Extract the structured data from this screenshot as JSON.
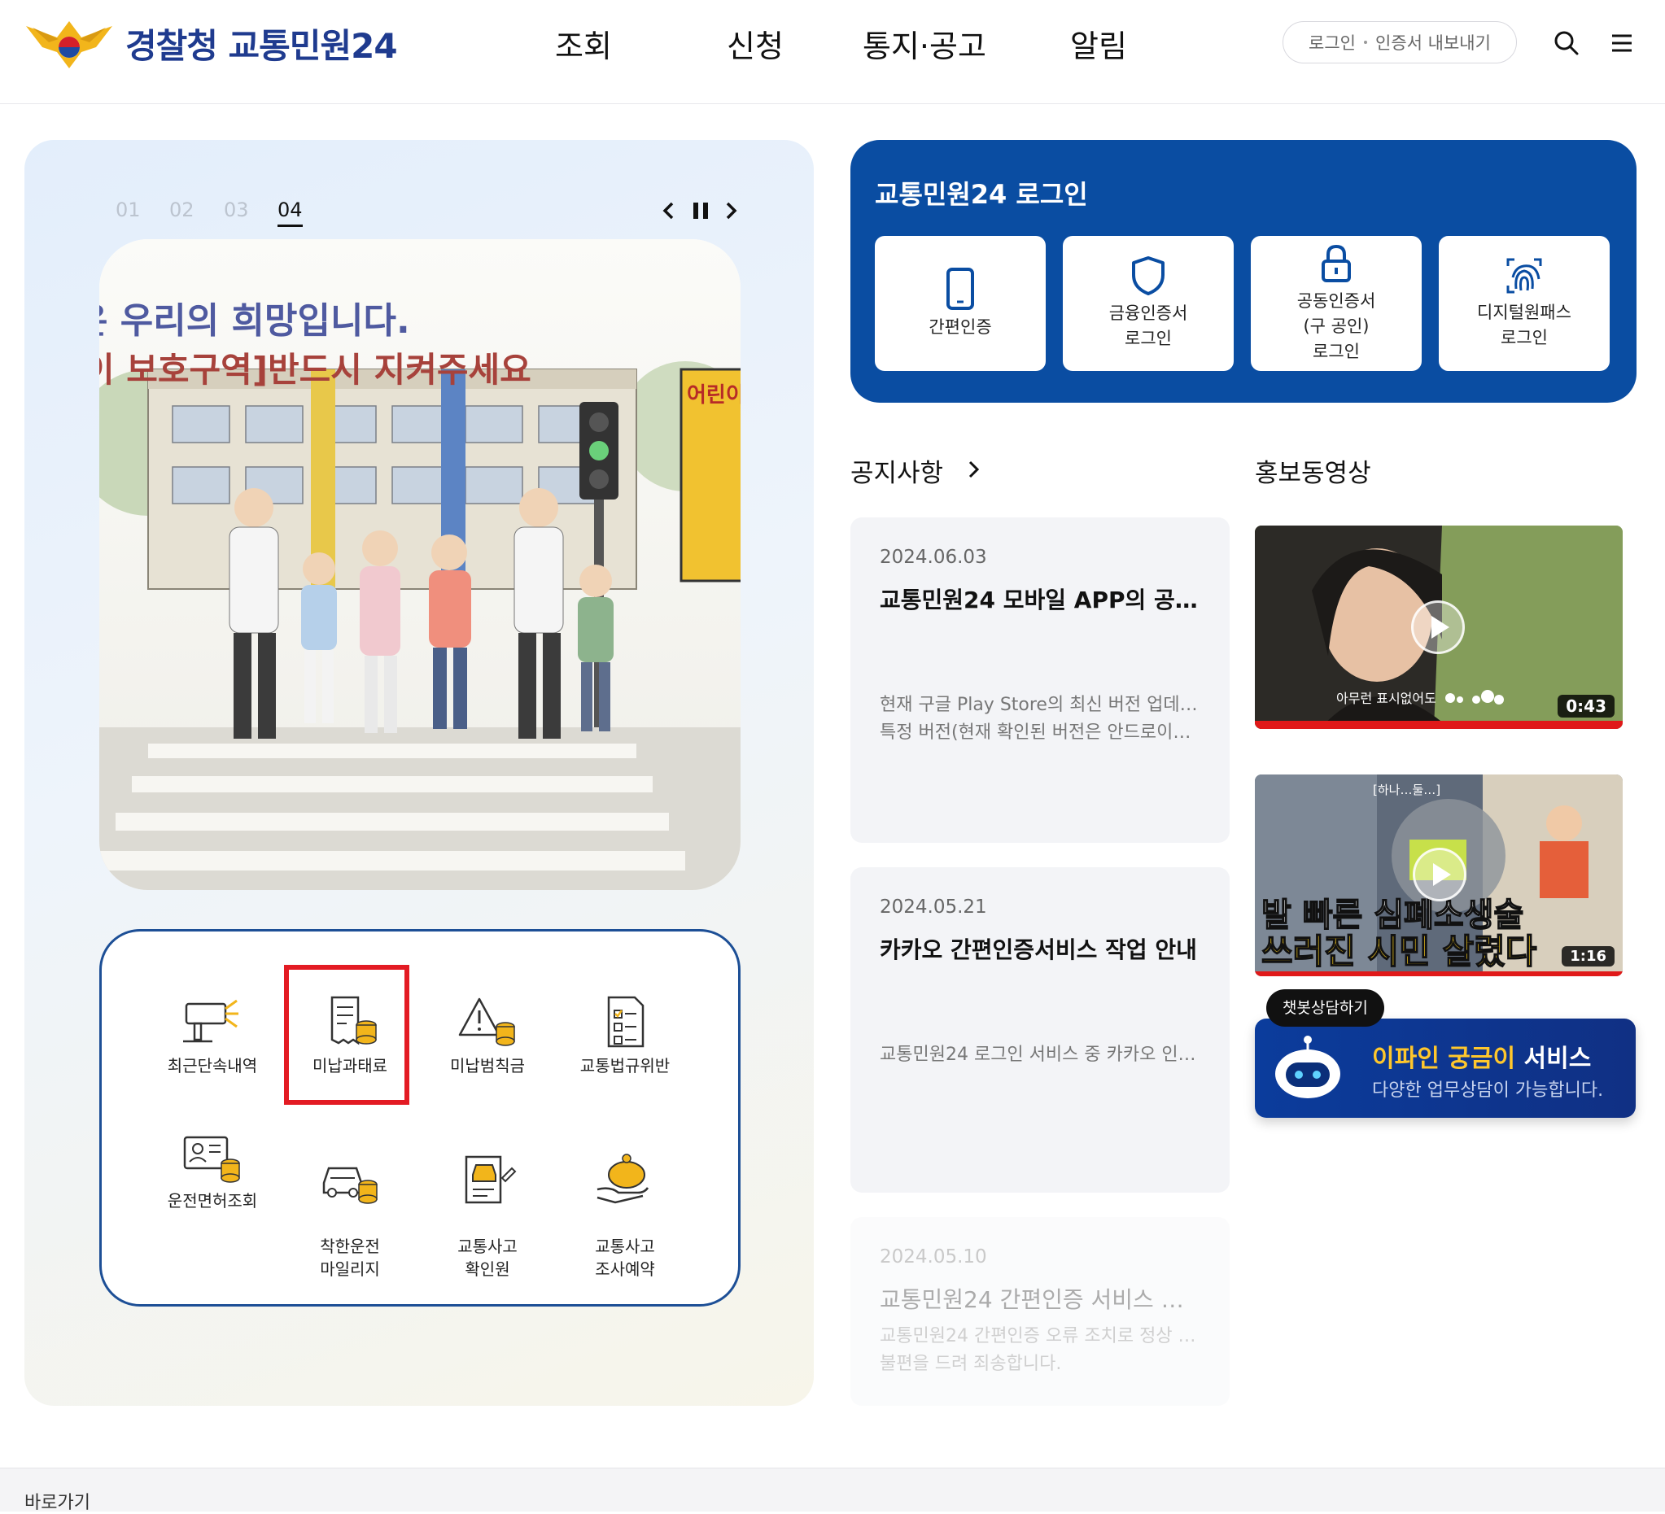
{
  "header": {
    "logo_text": "경찰청 교통민원24",
    "nav": [
      "조회",
      "신청",
      "통지·공고",
      "알림"
    ],
    "login_link": "로그인",
    "cert_export_link": "인증서 내보내기",
    "search_icon": "search-icon",
    "menu_icon": "hamburger-menu-icon"
  },
  "hero": {
    "slide_numbers": [
      "01",
      "02",
      "03",
      "04"
    ],
    "active_slide": "04",
    "slide_text_line1": "은 우리의 희망입니다.",
    "slide_text_line2": "이 보호구역]반드시 지켜주세요",
    "slide_sign": "어린이"
  },
  "quick_menu": [
    {
      "label": "최근단속내역",
      "icon": "speed-camera-icon"
    },
    {
      "label": "미납과태료",
      "icon": "receipt-coins-icon"
    },
    {
      "label": "미납범칙금",
      "icon": "warning-coins-icon"
    },
    {
      "label": "교통법규위반",
      "icon": "checklist-document-icon"
    },
    {
      "label": "운전면허조회",
      "icon": "license-card-coins-icon"
    },
    {
      "label": "착한운전\n마일리지",
      "icon": "car-coins-icon"
    },
    {
      "label": "교통사고\n확인원",
      "icon": "accident-report-icon"
    },
    {
      "label": "교통사고\n조사예약",
      "icon": "piggy-bank-hand-icon"
    }
  ],
  "login": {
    "title": "교통민원24 로그인",
    "options": [
      {
        "label": "간편인증",
        "icon": "mobile-phone-icon"
      },
      {
        "label": "금융인증서\n로그인",
        "icon": "shield-icon"
      },
      {
        "label": "공동인증서\n(구 공인)\n로그인",
        "icon": "lock-icon"
      },
      {
        "label": "디지털원패스\n로그인",
        "icon": "fingerprint-icon"
      }
    ]
  },
  "notices": {
    "title": "공지사항",
    "items": [
      {
        "date": "2024.06.03",
        "title": "교통민원24 모바일 APP의 공…",
        "body": [
          "현재 구글 Play Store의 최신 버전 업데…",
          "특정 버전(현재 확인된 버전은 안드로이…"
        ]
      },
      {
        "date": "2024.05.21",
        "title": "카카오 간편인증서비스 작업 안내",
        "body": [
          "교통민원24 로그인 서비스 중 카카오 인…"
        ]
      },
      {
        "date": "2024.05.10",
        "title": "교통민원24 간편인증 서비스 …",
        "body": [
          "교통민원24 간편인증 오류 조치로 정상 …",
          "불편을 드려 죄송합니다."
        ]
      }
    ]
  },
  "videos": {
    "title": "홍보동영상",
    "items": [
      {
        "duration": "0:43",
        "caption": "아무런 표시없어도"
      },
      {
        "duration": "1:16",
        "caption_line1": "발 빠른 심폐소생술",
        "caption_line2": "쓰러진 시민 살렸다",
        "tag": "[하나…둘…]"
      }
    ]
  },
  "chatbot": {
    "tag": "챗봇상담하기",
    "title_highlight": "이파인 궁금이",
    "title_rest": " 서비스",
    "subtitle": "다양한 업무상담이 가능합니다."
  },
  "footer": {
    "skip_link": "바로가기"
  },
  "colors": {
    "brand_blue": "#0a4da2",
    "highlight_red": "#e31b23",
    "chatbot_yellow": "#ffc72c"
  }
}
